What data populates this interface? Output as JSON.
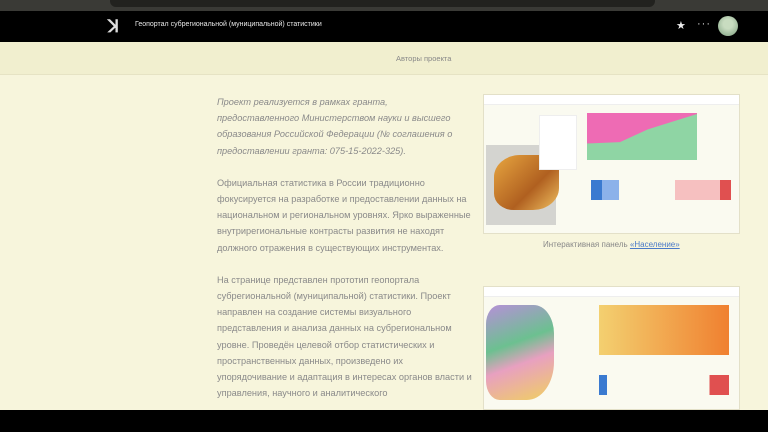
{
  "header": {
    "title": "Геопортал субрегиональной (муниципальной) статистики",
    "logo_icon": "logo-icon",
    "star_icon": "star-icon",
    "more_icon": "more-icon"
  },
  "subnav": {
    "authors": "Авторы проекта"
  },
  "content": {
    "para1": "Проект реализуется в рамках гранта, предоставленного Министерством науки и высшего образования Российской Федерации (№ соглашения о предоставлении гранта: 075-15-2022-325).",
    "para2": "Официальная статистика в России традиционно фокусируется на разработке и предоставлении данных на национальном и региональном уровнях. Ярко выраженные внутрирегиональные контрасты развития не находят должного отражения в существующих инструментах.",
    "para3": "На странице представлен прототип геопортала субрегиональной (муниципальной) статистики. Проект направлен на создание системы визуального представления и анализа данных на субрегиональном уровне. Проведён целевой отбор статистических и пространственных данных, произведено их упорядочивание и адаптация в интересах органов власти и управления, научного и аналитического"
  },
  "panels": {
    "caption_prefix": "Интерактивная панель ",
    "caption_link": "«Население»"
  }
}
